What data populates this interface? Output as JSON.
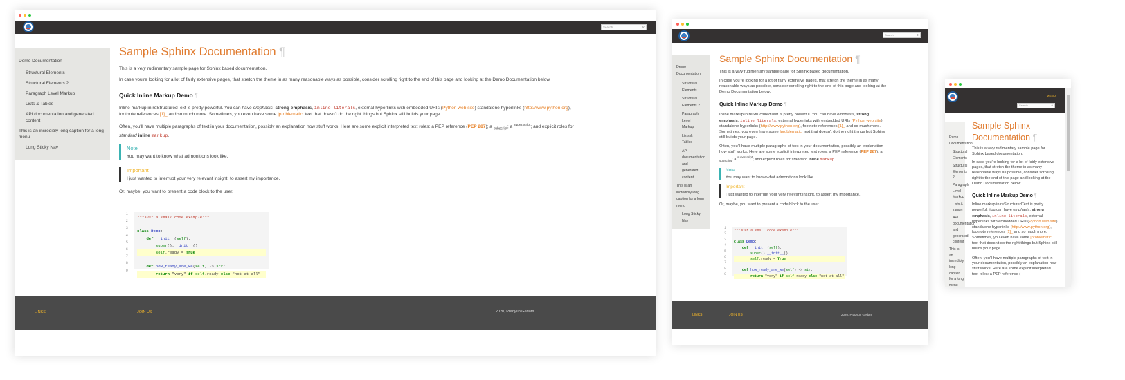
{
  "search": {
    "placeholder": "Search"
  },
  "menu_label": "MENU",
  "sidebar": {
    "items": [
      {
        "label": "Demo Documentation"
      },
      {
        "label": "Structural Elements"
      },
      {
        "label": "Structural Elements 2"
      },
      {
        "label": "Paragraph Level Markup"
      },
      {
        "label": "Lists & Tables"
      },
      {
        "label": "API documentation and generated content"
      },
      {
        "label": "This is an incredibly long caption for a long menu"
      },
      {
        "label": "Long Sticky Nav"
      }
    ]
  },
  "page": {
    "title": "Sample Sphinx Documentation",
    "pilcrow": "¶",
    "intro": {
      "pre": "This is a ",
      "em": "very",
      "post": " rudimentary sample page for Sphinx based documentation."
    },
    "case": "In case you're looking for a lot of fairly extensive pages, that stretch the theme in as many reasonable ways as possible, consider scrolling right to the end of this page and looking at the Demo Documentation below.",
    "section_title": "Quick Inline Markup Demo",
    "inline": {
      "p1": "Inline markup in reStructuredText is pretty powerful. You can have ",
      "emphasis": "emphasis",
      "comma": ", ",
      "strong": "strong emphasis",
      "literal": "inline literals",
      "p2": ", external hyperlinks with embedded URIs (",
      "link1": "Python web site",
      "p3": ") standalone hyperlinks (",
      "link2": "http://www.python.org",
      "p4": "), footnote references ",
      "fn": "[1]_",
      "p5": " and so much more. Sometimes, you even have some ",
      "prob": "|problematic|",
      "p6": " text that doesn't do the right things but Sphinx still builds your page."
    },
    "often": {
      "p1": "Often, you'll have multiple paragraphs of text in your documentation, possibly an explanation how stuff works. Here are some explicit interpreted text roles: a PEP reference (",
      "pep": "PEP 287",
      "p2": "); a ",
      "sub": "subscript",
      "p3": "; a ",
      "sup": "superscript",
      "p4": "; and explicit roles for ",
      "standard": "standard",
      "space": " ",
      "inline_b": "inline",
      "markup": "markup",
      "dot": "."
    },
    "note": {
      "title": "Note",
      "pre": "You may want to know what ",
      "em": "what",
      "post": " admonitions look like."
    },
    "important": {
      "title": "Important",
      "text": "I just wanted to interrupt your very relevant insight, to assert my importance."
    },
    "code_intro": "Or, maybe, you want to present a code block to the user.",
    "code_lines": [
      "1",
      "2",
      "3",
      "4",
      "5",
      "6",
      "7",
      "8",
      "9"
    ]
  },
  "footer": {
    "links": "LINKS",
    "join": "JOIN US",
    "copy": "2020, Pradyun Gedam"
  }
}
